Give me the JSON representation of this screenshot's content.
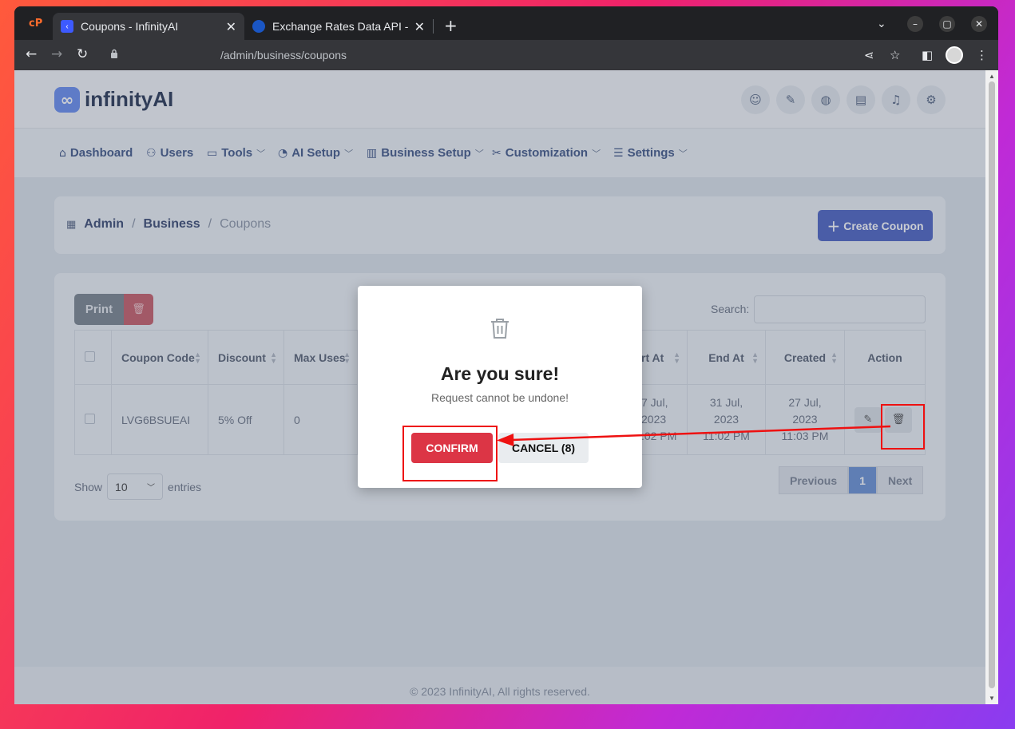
{
  "browser": {
    "tabs": [
      {
        "title": "Coupons - InfinityAI"
      },
      {
        "title": "Exchange Rates Data API -"
      }
    ],
    "url": "/admin/business/coupons"
  },
  "header": {
    "brand": "infinityAI",
    "brand_mark": "∞"
  },
  "nav": {
    "items": [
      {
        "label": "Dashboard"
      },
      {
        "label": "Users"
      },
      {
        "label": "Tools"
      },
      {
        "label": "AI Setup"
      },
      {
        "label": "Business Setup"
      },
      {
        "label": "Customization"
      },
      {
        "label": "Settings"
      }
    ]
  },
  "breadcrumb": {
    "items": [
      "Admin",
      "Business",
      "Coupons"
    ],
    "separator": "/"
  },
  "create_button": "Create Coupon",
  "table_tools": {
    "print_label": "Print",
    "search_label": "Search:"
  },
  "table": {
    "headers": [
      "Coupon Code",
      "Discount",
      "Max Uses",
      "Start At",
      "End At",
      "Created",
      "Action"
    ],
    "header_partial_start": "rt At",
    "rows": [
      {
        "code": "LVG6BSUEAI",
        "discount": "5% Off",
        "max_uses": "0",
        "start_partial": [
          "7 Jul,",
          "2023",
          ":02 PM"
        ],
        "end_at": [
          "31 Jul,",
          "2023",
          "11:02 PM"
        ],
        "created": [
          "27 Jul,",
          "2023",
          "11:03 PM"
        ]
      }
    ]
  },
  "length_menu": {
    "show": "Show",
    "value": "10",
    "entries": "entries"
  },
  "pagination": {
    "previous": "Previous",
    "current": "1",
    "next": "Next"
  },
  "footer": "© 2023 InfinityAI, All rights reserved.",
  "modal": {
    "title": "Are you sure!",
    "subtitle": "Request cannot be undone!",
    "confirm": "CONFIRM",
    "cancel": "CANCEL (8)"
  },
  "colors": {
    "confirm": "#dc3545",
    "primary": "#5066c4",
    "annotation": "#ee1111"
  }
}
